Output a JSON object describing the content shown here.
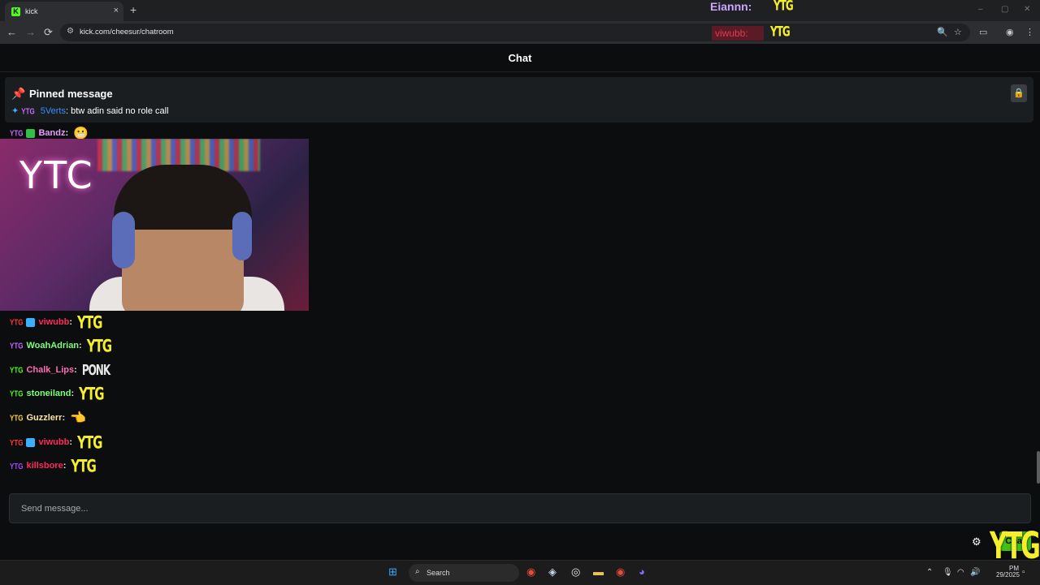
{
  "browser": {
    "tab_title": "kick",
    "tab_close": "×",
    "new_tab": "+",
    "url": "kick.com/cheesur/chatroom",
    "icons": {
      "back": "←",
      "forward": "→",
      "reload": "⟳",
      "site_settings": "⚙",
      "zoom": "🔍",
      "bookmark": "☆",
      "cast": "▭",
      "profile": "◉",
      "menu": "⋮",
      "minimize": "–",
      "maximize": "▢",
      "close": "✕"
    }
  },
  "overlay": {
    "username": "Eiannn:",
    "emote1": "YTG",
    "username2": "viwubb:",
    "emote2": "YTG"
  },
  "page": {
    "title": "Chat"
  },
  "pinned": {
    "title": "Pinned message",
    "sender": "5Verts",
    "text": ": btw adin said no role call",
    "icon": "pin-icon",
    "lock_icon": "🔒"
  },
  "messages": [
    {
      "user": "Bandz",
      "color": "#e99bff",
      "emote": "😬",
      "badge": "YTG",
      "badge_color": "#c468ff",
      "sub_color": "#30c04a"
    },
    {
      "user": "viwubb",
      "color": "#ff2a5a",
      "emote": "YTG",
      "badge": "YTG",
      "badge_color": "#ff3b3b",
      "sub_color": "#3bb0ff"
    },
    {
      "user": "WoahAdrian",
      "color": "#7dff7a",
      "emote": "YTG",
      "badge": "YTG",
      "badge_color": "#c468ff"
    },
    {
      "user": "Chalk_Lips",
      "color": "#ff6ab8",
      "emote": "PONK",
      "badge": "YTG",
      "badge_color": "#53fc18"
    },
    {
      "user": "stoneiland",
      "color": "#7dff7a",
      "emote": "YTG",
      "badge": "YTG",
      "badge_color": "#53fc18"
    },
    {
      "user": "Guzzlerr",
      "color": "#ffe3a6",
      "emote": "👈",
      "badge": "YTG",
      "badge_color": "#ffd23b"
    },
    {
      "user": "viwubb",
      "color": "#ff2a5a",
      "emote": "YTG",
      "badge": "YTG",
      "badge_color": "#ff3b3b",
      "sub_color": "#3bb0ff"
    },
    {
      "user": "killsbore",
      "color": "#ff2a5a",
      "emote": "YTG",
      "badge": "YTG",
      "badge_color": "#a24bff"
    }
  ],
  "video": {
    "overlay_text": "YTC"
  },
  "composer": {
    "placeholder": "Send message...",
    "send_label": "Chat",
    "settings_icon": "⚙",
    "overlay_emote": "YTG"
  },
  "taskbar": {
    "search_label": "Search",
    "date": "29/2025",
    "time_suffix": "PM"
  }
}
